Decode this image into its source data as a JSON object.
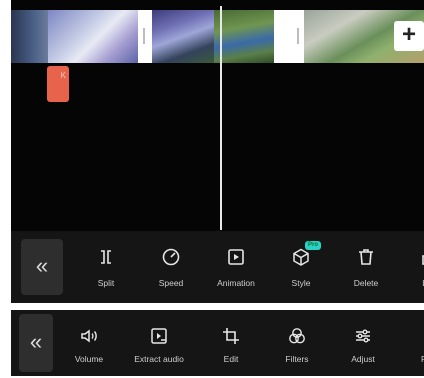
{
  "timeline": {
    "add_clip_label": "+",
    "text_clip_label": "K"
  },
  "toolbar_primary": {
    "back_icon": "«",
    "tools": [
      {
        "name": "split",
        "label": "Split",
        "icon": "split-icon"
      },
      {
        "name": "speed",
        "label": "Speed",
        "icon": "speed-icon"
      },
      {
        "name": "animation",
        "label": "Animation",
        "icon": "animation-icon"
      },
      {
        "name": "style",
        "label": "Style",
        "icon": "cube-icon",
        "badge": "Pro"
      },
      {
        "name": "delete",
        "label": "Delete",
        "icon": "trash-icon"
      },
      {
        "name": "lock",
        "label": "Lo",
        "icon": "lock-icon"
      }
    ]
  },
  "toolbar_secondary": {
    "back_icon": "«",
    "tools": [
      {
        "name": "volume",
        "label": "Volume",
        "icon": "volume-icon"
      },
      {
        "name": "extract-audio",
        "label": "Extract audio",
        "icon": "extract-audio-icon"
      },
      {
        "name": "edit",
        "label": "Edit",
        "icon": "crop-icon"
      },
      {
        "name": "filters",
        "label": "Filters",
        "icon": "filters-icon"
      },
      {
        "name": "adjust",
        "label": "Adjust",
        "icon": "sliders-icon"
      },
      {
        "name": "format",
        "label": "Fo",
        "icon": "format-icon"
      }
    ]
  },
  "colors": {
    "background": "#050505",
    "toolbar": "#151515",
    "text_clip": "#e8634c",
    "badge": "#2ad1c4"
  }
}
